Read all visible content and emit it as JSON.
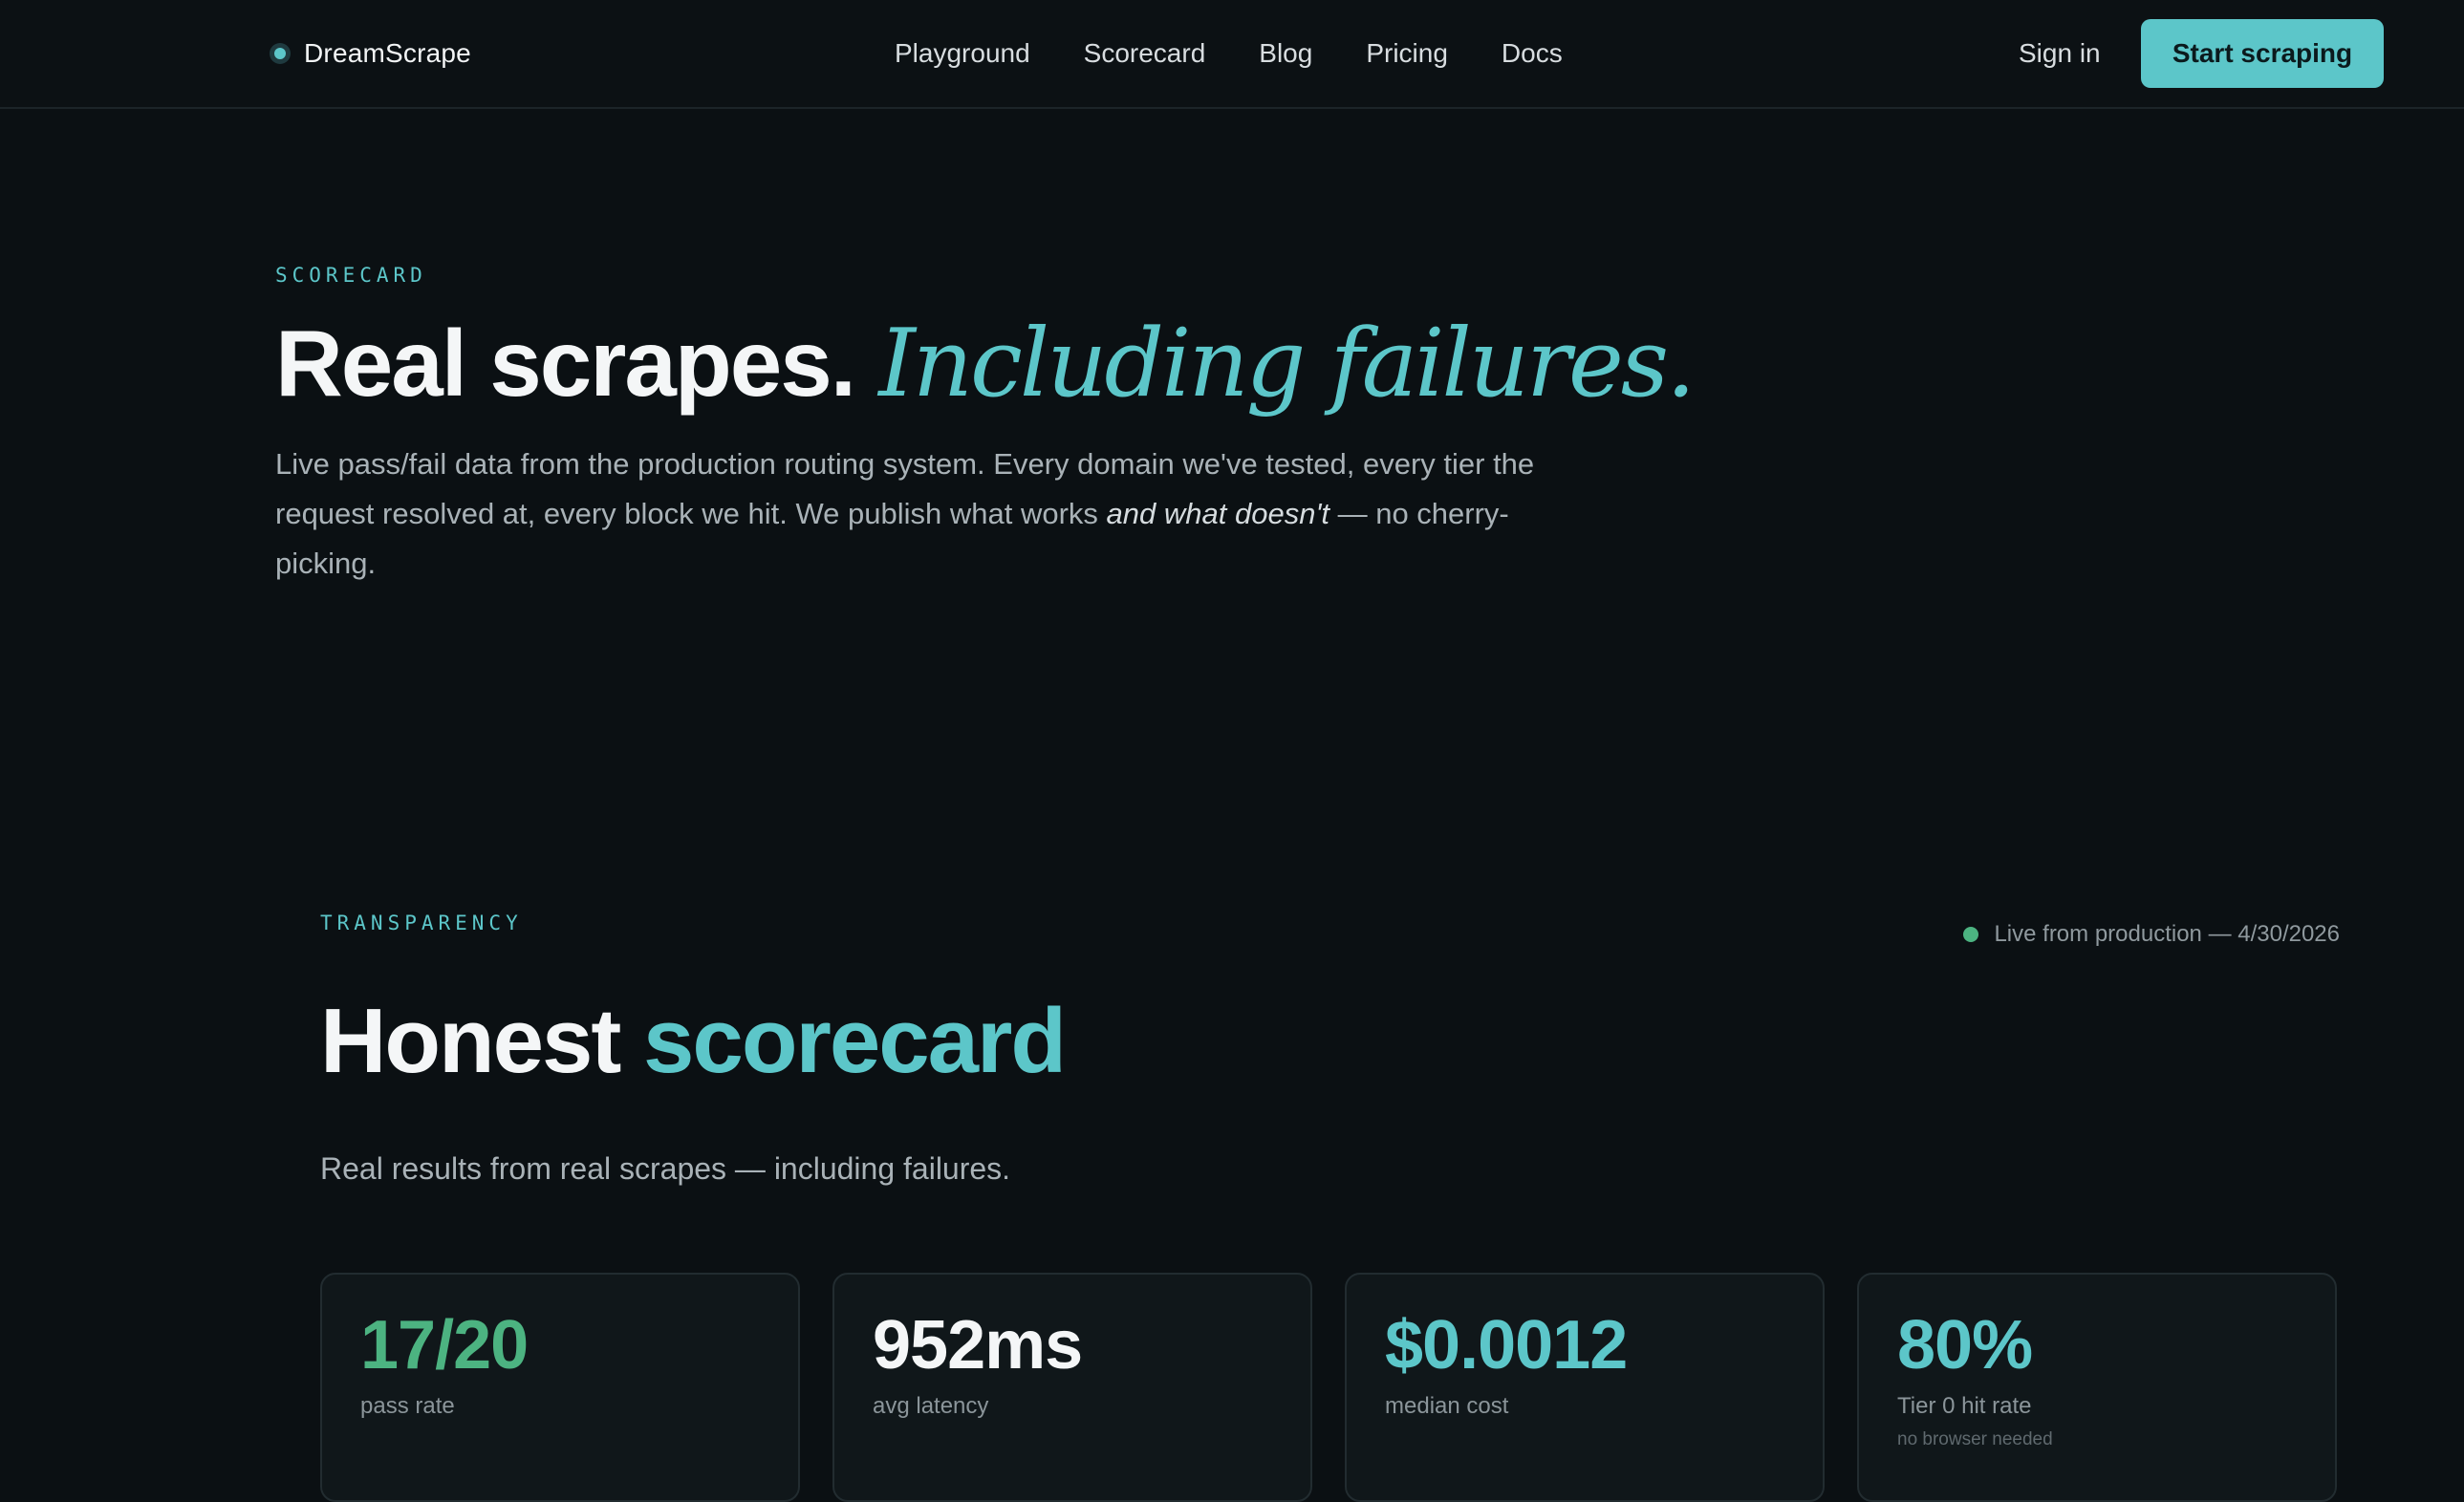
{
  "nav": {
    "brand": "DreamScrape",
    "links": [
      "Playground",
      "Scorecard",
      "Blog",
      "Pricing",
      "Docs"
    ],
    "sign_in": "Sign in",
    "cta": "Start scraping"
  },
  "hero": {
    "eyebrow": "SCORECARD",
    "title_main": "Real scrapes.",
    "title_accent": "Including failures.",
    "desc_part1": "Live pass/fail data from the production routing system. Every domain we've tested, every tier the request resolved at, every block we hit. We publish what works ",
    "desc_emph": "and what doesn't",
    "desc_part2": " — no cherry-picking."
  },
  "scorecard": {
    "eyebrow": "TRANSPARENCY",
    "live_status": "Live from production — 4/30/2026",
    "live_color": "#4cb381",
    "title_main": "Honest",
    "title_accent": "scorecard",
    "subtitle": "Real results from real scrapes — including failures.",
    "stats": [
      {
        "value": "17/20",
        "label": "pass rate",
        "note": "",
        "color": "#4cb381"
      },
      {
        "value": "952ms",
        "label": "avg latency",
        "note": "",
        "color": "#f4f6f7"
      },
      {
        "value": "$0.0012",
        "label": "median cost",
        "note": "",
        "color": "#5cc6c9"
      },
      {
        "value": "80%",
        "label": "Tier 0 hit rate",
        "note": "no browser needed",
        "color": "#5cc6c9"
      }
    ]
  },
  "colors": {
    "accent": "#5cc6c9",
    "background": "#0b1013"
  }
}
